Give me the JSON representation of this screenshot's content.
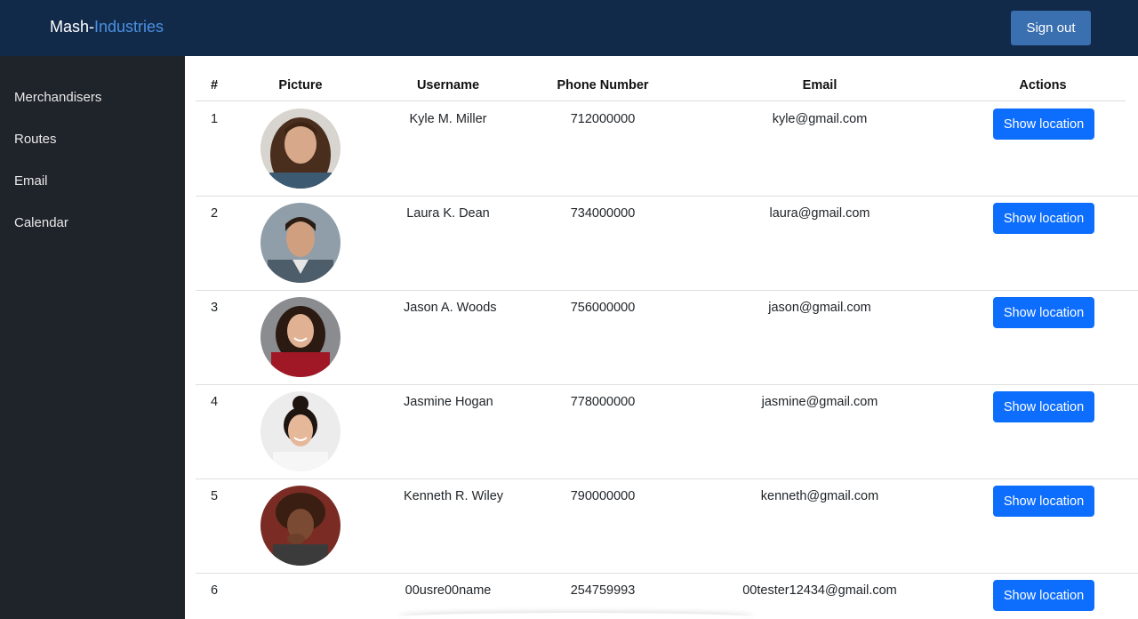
{
  "header": {
    "brand_prefix": "Mash-",
    "brand_suffix": "Industries",
    "signout_label": "Sign out"
  },
  "sidebar": {
    "items": [
      {
        "label": "Merchandisers"
      },
      {
        "label": "Routes"
      },
      {
        "label": "Email"
      },
      {
        "label": "Calendar"
      }
    ]
  },
  "table": {
    "columns": [
      "#",
      "Picture",
      "Username",
      "Phone Number",
      "Email",
      "Actions"
    ],
    "rows": [
      {
        "num": "1",
        "username": "Kyle M. Miller",
        "phone": "712000000",
        "email": "kyle@gmail.com",
        "action": "Show location"
      },
      {
        "num": "2",
        "username": "Laura K. Dean",
        "phone": "734000000",
        "email": "laura@gmail.com",
        "action": "Show location"
      },
      {
        "num": "3",
        "username": "Jason A. Woods",
        "phone": "756000000",
        "email": "jason@gmail.com",
        "action": "Show location"
      },
      {
        "num": "4",
        "username": "Jasmine Hogan",
        "phone": "778000000",
        "email": "jasmine@gmail.com",
        "action": "Show location"
      },
      {
        "num": "5",
        "username": "Kenneth R. Wiley",
        "phone": "790000000",
        "email": "kenneth@gmail.com",
        "action": "Show location"
      },
      {
        "num": "6",
        "username": "00usre00name",
        "phone": "254759993",
        "email": "00tester12434@gmail.com",
        "action": "Show location"
      }
    ]
  },
  "colors": {
    "topbar": "#122a4a",
    "sidebar": "#1f232a",
    "brand_accent": "#4a90e2",
    "signout_button": "#3a6fb0",
    "action_button": "#0d6efd"
  }
}
